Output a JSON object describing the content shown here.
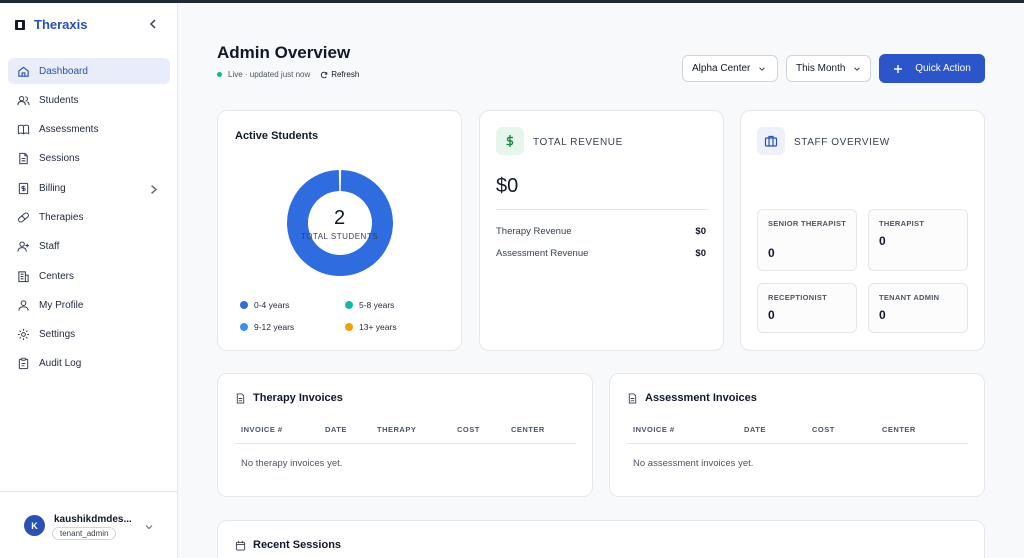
{
  "sidebar": {
    "brand": "Theraxis",
    "items": [
      {
        "label": "Dashboard",
        "icon": "home-icon",
        "active": true
      },
      {
        "label": "Students",
        "icon": "users-icon"
      },
      {
        "label": "Assessments",
        "icon": "book-icon"
      },
      {
        "label": "Sessions",
        "icon": "document-icon"
      },
      {
        "label": "Billing",
        "icon": "receipt-icon",
        "has_chevron": true
      },
      {
        "label": "Therapies",
        "icon": "pill-icon"
      },
      {
        "label": "Staff",
        "icon": "user-plus-icon"
      },
      {
        "label": "Centers",
        "icon": "building-icon"
      },
      {
        "label": "My Profile",
        "icon": "user-icon"
      },
      {
        "label": "Settings",
        "icon": "gear-icon"
      },
      {
        "label": "Audit Log",
        "icon": "clipboard-icon"
      }
    ],
    "user": {
      "initial": "K",
      "name": "kaushikdmdes...",
      "role": "tenant_admin"
    }
  },
  "header": {
    "title": "Admin Overview",
    "live_text": "Live · updated just now",
    "refresh_label": "Refresh",
    "center_select": "Alpha Center",
    "period_select": "This Month",
    "quick_action_label": "Quick Action"
  },
  "colors": {
    "accent": "#2b55c8",
    "brand": "#2b50b4",
    "live": "#10b981",
    "age_0_4": "#2f6ce0",
    "age_5_8": "#14b8a6",
    "age_9_12": "#3b8ff0",
    "age_13_plus": "#f59e0b"
  },
  "active_students": {
    "title": "Active Students",
    "total": "2",
    "total_label": "TOTAL STUDENTS",
    "legend": [
      {
        "label": "0-4 years"
      },
      {
        "label": "5-8 years"
      },
      {
        "label": "9-12 years"
      },
      {
        "label": "13+ years"
      }
    ]
  },
  "chart_data": {
    "type": "pie",
    "categories": [
      "0-4 years",
      "5-8 years",
      "9-12 years",
      "13+ years"
    ],
    "values": [
      2,
      0,
      0,
      0
    ],
    "center_value": "2",
    "center_label": "TOTAL STUDENTS"
  },
  "revenue": {
    "label": "TOTAL REVENUE",
    "total": "$0",
    "rows": [
      {
        "label": "Therapy Revenue",
        "amount": "$0"
      },
      {
        "label": "Assessment Revenue",
        "amount": "$0"
      }
    ]
  },
  "staff": {
    "label": "STAFF OVERVIEW",
    "roles": [
      {
        "label": "SENIOR THERAPIST",
        "count": "0"
      },
      {
        "label": "THERAPIST",
        "count": "0"
      },
      {
        "label": "RECEPTIONIST",
        "count": "0"
      },
      {
        "label": "TENANT ADMIN",
        "count": "0"
      }
    ]
  },
  "therapy_invoices": {
    "title": "Therapy Invoices",
    "columns": [
      "INVOICE #",
      "DATE",
      "THERAPY",
      "COST",
      "CENTER"
    ],
    "empty": "No therapy invoices yet."
  },
  "assessment_invoices": {
    "title": "Assessment Invoices",
    "columns": [
      "INVOICE #",
      "DATE",
      "COST",
      "CENTER"
    ],
    "empty": "No assessment invoices yet."
  },
  "recent_sessions": {
    "title": "Recent Sessions"
  }
}
